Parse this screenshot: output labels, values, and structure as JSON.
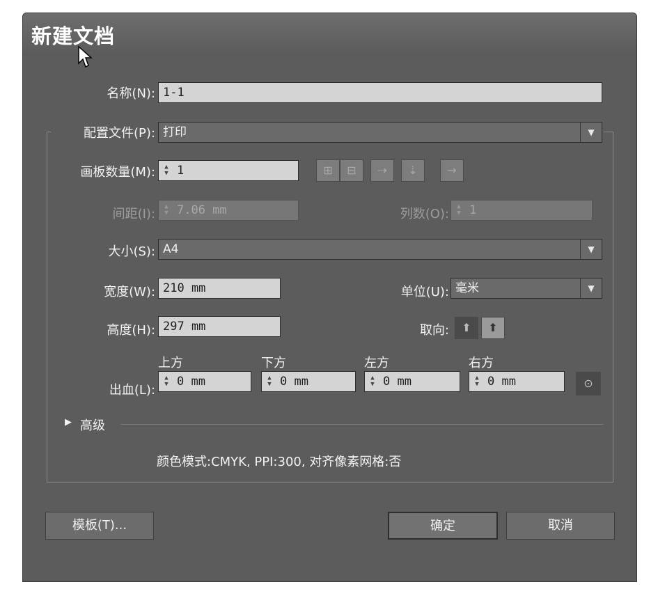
{
  "dialog": {
    "title": "新建文档"
  },
  "form": {
    "name_label": "名称(N):",
    "name_value": "1-1",
    "profile_label": "配置文件(P):",
    "profile_value": "打印",
    "artboards_label": "画板数量(M):",
    "artboards_value": "1",
    "spacing_label": "间距(I):",
    "spacing_value": "7.06 mm",
    "columns_label": "列数(O):",
    "columns_value": "1",
    "size_label": "大小(S):",
    "size_value": "A4",
    "width_label": "宽度(W):",
    "width_value": "210 mm",
    "units_label": "单位(U):",
    "units_value": "毫米",
    "height_label": "高度(H):",
    "height_value": "297 mm",
    "orientation_label": "取向:",
    "bleed_label": "出血(L):",
    "bleed": [
      {
        "head": "上方",
        "value": "0 mm"
      },
      {
        "head": "下方",
        "value": "0 mm"
      },
      {
        "head": "左方",
        "value": "0 mm"
      },
      {
        "head": "右方",
        "value": "0 mm"
      }
    ],
    "advanced_label": "高级",
    "summary": "颜色模式:CMYK, PPI:300, 对齐像素网格:否"
  },
  "buttons": {
    "templates": "模板(T)...",
    "ok": "确定",
    "cancel": "取消"
  }
}
